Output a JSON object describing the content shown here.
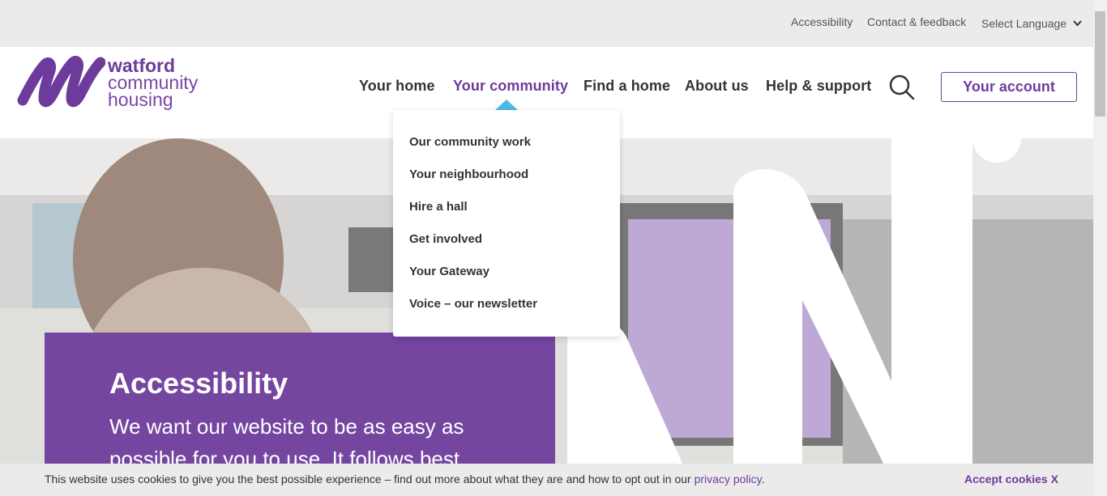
{
  "utility": {
    "accessibility": "Accessibility",
    "contact": "Contact & feedback",
    "language": "Select Language"
  },
  "logo": {
    "line1": "watford",
    "line2": "community",
    "line3": "housing"
  },
  "nav": {
    "items": [
      {
        "label": "Your home"
      },
      {
        "label": "Your community"
      },
      {
        "label": "Find a home"
      },
      {
        "label": "About us"
      },
      {
        "label": "Help & support"
      }
    ],
    "account": "Your account"
  },
  "dropdown": {
    "items": [
      {
        "label": "Our community work"
      },
      {
        "label": "Your neighbourhood"
      },
      {
        "label": "Hire a hall"
      },
      {
        "label": "Get involved"
      },
      {
        "label": "Your Gateway"
      },
      {
        "label": "Voice – our newsletter"
      }
    ]
  },
  "hero": {
    "title": "Accessibility",
    "text": "We want our website to be as easy as possible for you to use. It follows best"
  },
  "cookie": {
    "text": "This website uses cookies to give you the best possible experience – find out more about what they are and how to opt out in our ",
    "link": "privacy policy",
    "after": ".",
    "accept": "Accept cookies X"
  },
  "colors": {
    "brand_purple": "#6d3b9c",
    "panel_purple": "#7446a0",
    "accent_blue": "#4cb9e7"
  }
}
